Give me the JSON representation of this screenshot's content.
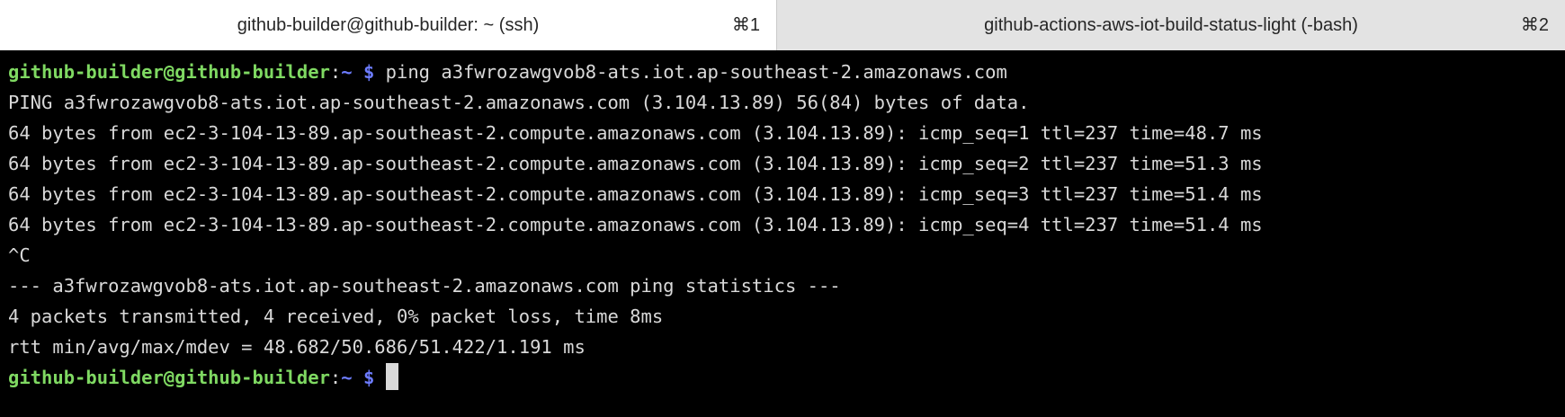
{
  "tabs": [
    {
      "title": "github-builder@github-builder: ~ (ssh)",
      "shortcut": "⌘1",
      "active": true
    },
    {
      "title": "github-actions-aws-iot-build-status-light (-bash)",
      "shortcut": "⌘2",
      "active": false
    }
  ],
  "terminal": {
    "prompt_user": "github-builder@github-builder",
    "prompt_colon": ":",
    "prompt_path": "~ $",
    "command": " ping a3fwrozawgvob8-ats.iot.ap-southeast-2.amazonaws.com",
    "output": [
      "PING a3fwrozawgvob8-ats.iot.ap-southeast-2.amazonaws.com (3.104.13.89) 56(84) bytes of data.",
      "64 bytes from ec2-3-104-13-89.ap-southeast-2.compute.amazonaws.com (3.104.13.89): icmp_seq=1 ttl=237 time=48.7 ms",
      "64 bytes from ec2-3-104-13-89.ap-southeast-2.compute.amazonaws.com (3.104.13.89): icmp_seq=2 ttl=237 time=51.3 ms",
      "64 bytes from ec2-3-104-13-89.ap-southeast-2.compute.amazonaws.com (3.104.13.89): icmp_seq=3 ttl=237 time=51.4 ms",
      "64 bytes from ec2-3-104-13-89.ap-southeast-2.compute.amazonaws.com (3.104.13.89): icmp_seq=4 ttl=237 time=51.4 ms",
      "^C",
      "--- a3fwrozawgvob8-ats.iot.ap-southeast-2.amazonaws.com ping statistics ---",
      "4 packets transmitted, 4 received, 0% packet loss, time 8ms",
      "rtt min/avg/max/mdev = 48.682/50.686/51.422/1.191 ms"
    ],
    "colors": {
      "background": "#000000",
      "text": "#d9d9d9",
      "prompt_user": "#7fd962",
      "prompt_path": "#6d7cff"
    }
  }
}
